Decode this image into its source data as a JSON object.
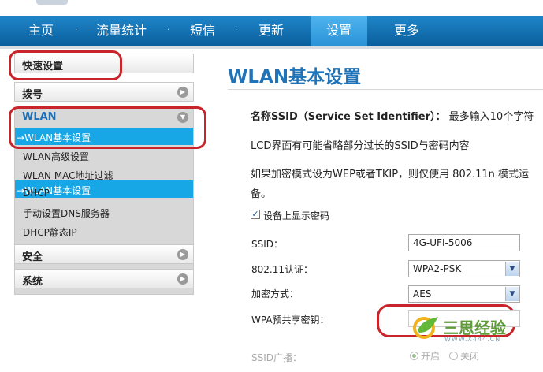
{
  "nav": {
    "items": [
      {
        "label": "主页"
      },
      {
        "label": "流量统计"
      },
      {
        "label": "短信"
      },
      {
        "label": "更新"
      },
      {
        "label": "设置",
        "active": true
      },
      {
        "label": "更多"
      }
    ],
    "active_color": "#3ba6e6",
    "bar_color": "#0e69a9"
  },
  "sidebar": {
    "quick": "快速设置",
    "dial": "拨号",
    "wlan": "WLAN",
    "wlan_items": [
      "→WLAN基本设置",
      "WLAN高级设置",
      "WLAN MAC地址过滤",
      "DHCP",
      "手动设置DNS服务器",
      "DHCP静态IP"
    ],
    "security": "安全",
    "system": "系统"
  },
  "main": {
    "title": "WLAN基本设置",
    "ssid_note_label": "名称SSID（Service Set Identifier）：",
    "ssid_note": "最多输入10个字符",
    "lcd_note": "LCD界面有可能省略部分过长的SSID与密码内容",
    "encrypt_note_1": "如果加密模式设为WEP或者TKIP，则仅使用 802.11n 模式运",
    "encrypt_note_2": "备。",
    "show_pwd_label": "设备上显示密码",
    "show_pwd_checked": "✓",
    "ssid_label": "SSID：",
    "ssid_value": "4G-UFI-5006",
    "auth_label": "802.11认证：",
    "auth_value": "WPA2-PSK",
    "enc_label": "加密方式：",
    "enc_value": "AES",
    "psk_label": "WPA预共享密钥：",
    "broadcast_label": "SSID广播：",
    "broadcast_on": "开启",
    "broadcast_off": "关闭"
  },
  "watermark": {
    "name": "三思经验",
    "url": "WWW.X444.CN"
  },
  "colors": {
    "highlight_ring": "#c7252b",
    "title": "#1f73b8",
    "active_sub": "#18a7e6"
  }
}
